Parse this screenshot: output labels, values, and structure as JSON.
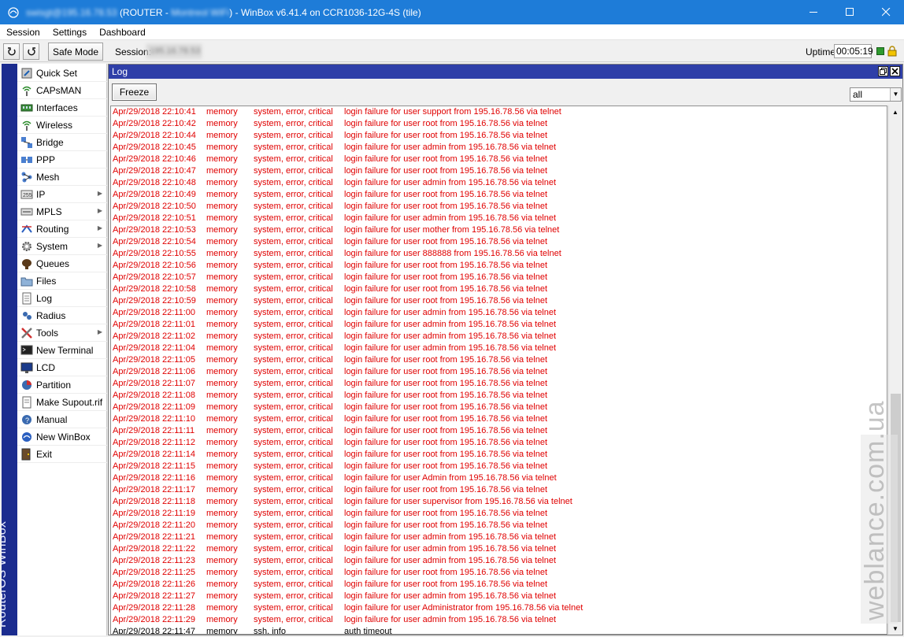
{
  "window": {
    "title_user_host": "swisgt@195.16.78.53",
    "title_router": "(ROUTER - ",
    "title_router_blurred": "Montreol WiFi",
    "title_suffix": ") - WinBox v6.41.4 on CCR1036-12G-4S (tile)",
    "controls": [
      "minimize",
      "maximize",
      "close"
    ]
  },
  "menubar": {
    "items": [
      "Session",
      "Settings",
      "Dashboard"
    ]
  },
  "toolbar": {
    "undo_icon": "undo-icon",
    "redo_icon": "redo-icon",
    "safe_mode_label": "Safe Mode",
    "session_label": "Session:",
    "session_value": "195.16.78.53",
    "uptime_label": "Uptime:",
    "uptime_value": "00:05:19",
    "status_color": "#2e9a2e"
  },
  "brand": {
    "text": "RouterOS WinBox"
  },
  "sidebar": {
    "items": [
      {
        "label": "Quick Set",
        "icon": "quickset-icon",
        "submenu": false
      },
      {
        "label": "CAPsMAN",
        "icon": "capsman-icon",
        "submenu": false
      },
      {
        "label": "Interfaces",
        "icon": "interfaces-icon",
        "submenu": false
      },
      {
        "label": "Wireless",
        "icon": "wireless-icon",
        "submenu": false
      },
      {
        "label": "Bridge",
        "icon": "bridge-icon",
        "submenu": false
      },
      {
        "label": "PPP",
        "icon": "ppp-icon",
        "submenu": false
      },
      {
        "label": "Mesh",
        "icon": "mesh-icon",
        "submenu": false
      },
      {
        "label": "IP",
        "icon": "ip-icon",
        "submenu": true
      },
      {
        "label": "MPLS",
        "icon": "mpls-icon",
        "submenu": true
      },
      {
        "label": "Routing",
        "icon": "routing-icon",
        "submenu": true
      },
      {
        "label": "System",
        "icon": "system-icon",
        "submenu": true
      },
      {
        "label": "Queues",
        "icon": "queues-icon",
        "submenu": false
      },
      {
        "label": "Files",
        "icon": "files-icon",
        "submenu": false
      },
      {
        "label": "Log",
        "icon": "log-icon",
        "submenu": false
      },
      {
        "label": "Radius",
        "icon": "radius-icon",
        "submenu": false
      },
      {
        "label": "Tools",
        "icon": "tools-icon",
        "submenu": true
      },
      {
        "label": "New Terminal",
        "icon": "terminal-icon",
        "submenu": false
      },
      {
        "label": "LCD",
        "icon": "lcd-icon",
        "submenu": false
      },
      {
        "label": "Partition",
        "icon": "partition-icon",
        "submenu": false
      },
      {
        "label": "Make Supout.rif",
        "icon": "supout-icon",
        "submenu": false
      },
      {
        "label": "Manual",
        "icon": "manual-icon",
        "submenu": false
      },
      {
        "label": "New WinBox",
        "icon": "winbox-icon",
        "submenu": false
      },
      {
        "label": "Exit",
        "icon": "exit-icon",
        "submenu": false
      }
    ]
  },
  "log_window": {
    "title": "Log",
    "freeze_label": "Freeze",
    "filter_value": "all",
    "error_color": "#e00000",
    "rows": [
      {
        "time": "Apr/29/2018 22:10:41",
        "buffer": "memory",
        "topics": "system, error, critical",
        "message": "login failure for user support from 195.16.78.56 via telnet",
        "level": "err"
      },
      {
        "time": "Apr/29/2018 22:10:42",
        "buffer": "memory",
        "topics": "system, error, critical",
        "message": "login failure for user root from 195.16.78.56 via telnet",
        "level": "err"
      },
      {
        "time": "Apr/29/2018 22:10:44",
        "buffer": "memory",
        "topics": "system, error, critical",
        "message": "login failure for user root from 195.16.78.56 via telnet",
        "level": "err"
      },
      {
        "time": "Apr/29/2018 22:10:45",
        "buffer": "memory",
        "topics": "system, error, critical",
        "message": "login failure for user admin from 195.16.78.56 via telnet",
        "level": "err"
      },
      {
        "time": "Apr/29/2018 22:10:46",
        "buffer": "memory",
        "topics": "system, error, critical",
        "message": "login failure for user root from 195.16.78.56 via telnet",
        "level": "err"
      },
      {
        "time": "Apr/29/2018 22:10:47",
        "buffer": "memory",
        "topics": "system, error, critical",
        "message": "login failure for user root from 195.16.78.56 via telnet",
        "level": "err"
      },
      {
        "time": "Apr/29/2018 22:10:48",
        "buffer": "memory",
        "topics": "system, error, critical",
        "message": "login failure for user admin from 195.16.78.56 via telnet",
        "level": "err"
      },
      {
        "time": "Apr/29/2018 22:10:49",
        "buffer": "memory",
        "topics": "system, error, critical",
        "message": "login failure for user root from 195.16.78.56 via telnet",
        "level": "err"
      },
      {
        "time": "Apr/29/2018 22:10:50",
        "buffer": "memory",
        "topics": "system, error, critical",
        "message": "login failure for user root from 195.16.78.56 via telnet",
        "level": "err"
      },
      {
        "time": "Apr/29/2018 22:10:51",
        "buffer": "memory",
        "topics": "system, error, critical",
        "message": "login failure for user admin from 195.16.78.56 via telnet",
        "level": "err"
      },
      {
        "time": "Apr/29/2018 22:10:53",
        "buffer": "memory",
        "topics": "system, error, critical",
        "message": "login failure for user mother from 195.16.78.56 via telnet",
        "level": "err"
      },
      {
        "time": "Apr/29/2018 22:10:54",
        "buffer": "memory",
        "topics": "system, error, critical",
        "message": "login failure for user root from 195.16.78.56 via telnet",
        "level": "err"
      },
      {
        "time": "Apr/29/2018 22:10:55",
        "buffer": "memory",
        "topics": "system, error, critical",
        "message": "login failure for user 888888 from 195.16.78.56 via telnet",
        "level": "err"
      },
      {
        "time": "Apr/29/2018 22:10:56",
        "buffer": "memory",
        "topics": "system, error, critical",
        "message": "login failure for user root from 195.16.78.56 via telnet",
        "level": "err"
      },
      {
        "time": "Apr/29/2018 22:10:57",
        "buffer": "memory",
        "topics": "system, error, critical",
        "message": "login failure for user root from 195.16.78.56 via telnet",
        "level": "err"
      },
      {
        "time": "Apr/29/2018 22:10:58",
        "buffer": "memory",
        "topics": "system, error, critical",
        "message": "login failure for user root from 195.16.78.56 via telnet",
        "level": "err"
      },
      {
        "time": "Apr/29/2018 22:10:59",
        "buffer": "memory",
        "topics": "system, error, critical",
        "message": "login failure for user root from 195.16.78.56 via telnet",
        "level": "err"
      },
      {
        "time": "Apr/29/2018 22:11:00",
        "buffer": "memory",
        "topics": "system, error, critical",
        "message": "login failure for user admin from 195.16.78.56 via telnet",
        "level": "err"
      },
      {
        "time": "Apr/29/2018 22:11:01",
        "buffer": "memory",
        "topics": "system, error, critical",
        "message": "login failure for user admin from 195.16.78.56 via telnet",
        "level": "err"
      },
      {
        "time": "Apr/29/2018 22:11:02",
        "buffer": "memory",
        "topics": "system, error, critical",
        "message": "login failure for user admin from 195.16.78.56 via telnet",
        "level": "err"
      },
      {
        "time": "Apr/29/2018 22:11:04",
        "buffer": "memory",
        "topics": "system, error, critical",
        "message": "login failure for user admin from 195.16.78.56 via telnet",
        "level": "err"
      },
      {
        "time": "Apr/29/2018 22:11:05",
        "buffer": "memory",
        "topics": "system, error, critical",
        "message": "login failure for user root from 195.16.78.56 via telnet",
        "level": "err"
      },
      {
        "time": "Apr/29/2018 22:11:06",
        "buffer": "memory",
        "topics": "system, error, critical",
        "message": "login failure for user root from 195.16.78.56 via telnet",
        "level": "err"
      },
      {
        "time": "Apr/29/2018 22:11:07",
        "buffer": "memory",
        "topics": "system, error, critical",
        "message": "login failure for user root from 195.16.78.56 via telnet",
        "level": "err"
      },
      {
        "time": "Apr/29/2018 22:11:08",
        "buffer": "memory",
        "topics": "system, error, critical",
        "message": "login failure for user root from 195.16.78.56 via telnet",
        "level": "err"
      },
      {
        "time": "Apr/29/2018 22:11:09",
        "buffer": "memory",
        "topics": "system, error, critical",
        "message": "login failure for user root from 195.16.78.56 via telnet",
        "level": "err"
      },
      {
        "time": "Apr/29/2018 22:11:10",
        "buffer": "memory",
        "topics": "system, error, critical",
        "message": "login failure for user root from 195.16.78.56 via telnet",
        "level": "err"
      },
      {
        "time": "Apr/29/2018 22:11:11",
        "buffer": "memory",
        "topics": "system, error, critical",
        "message": "login failure for user root from 195.16.78.56 via telnet",
        "level": "err"
      },
      {
        "time": "Apr/29/2018 22:11:12",
        "buffer": "memory",
        "topics": "system, error, critical",
        "message": "login failure for user root from 195.16.78.56 via telnet",
        "level": "err"
      },
      {
        "time": "Apr/29/2018 22:11:14",
        "buffer": "memory",
        "topics": "system, error, critical",
        "message": "login failure for user root from 195.16.78.56 via telnet",
        "level": "err"
      },
      {
        "time": "Apr/29/2018 22:11:15",
        "buffer": "memory",
        "topics": "system, error, critical",
        "message": "login failure for user root from 195.16.78.56 via telnet",
        "level": "err"
      },
      {
        "time": "Apr/29/2018 22:11:16",
        "buffer": "memory",
        "topics": "system, error, critical",
        "message": "login failure for user Admin from 195.16.78.56 via telnet",
        "level": "err"
      },
      {
        "time": "Apr/29/2018 22:11:17",
        "buffer": "memory",
        "topics": "system, error, critical",
        "message": "login failure for user root from 195.16.78.56 via telnet",
        "level": "err"
      },
      {
        "time": "Apr/29/2018 22:11:18",
        "buffer": "memory",
        "topics": "system, error, critical",
        "message": "login failure for user supervisor from 195.16.78.56 via telnet",
        "level": "err"
      },
      {
        "time": "Apr/29/2018 22:11:19",
        "buffer": "memory",
        "topics": "system, error, critical",
        "message": "login failure for user root from 195.16.78.56 via telnet",
        "level": "err"
      },
      {
        "time": "Apr/29/2018 22:11:20",
        "buffer": "memory",
        "topics": "system, error, critical",
        "message": "login failure for user root from 195.16.78.56 via telnet",
        "level": "err"
      },
      {
        "time": "Apr/29/2018 22:11:21",
        "buffer": "memory",
        "topics": "system, error, critical",
        "message": "login failure for user admin from 195.16.78.56 via telnet",
        "level": "err"
      },
      {
        "time": "Apr/29/2018 22:11:22",
        "buffer": "memory",
        "topics": "system, error, critical",
        "message": "login failure for user admin from 195.16.78.56 via telnet",
        "level": "err"
      },
      {
        "time": "Apr/29/2018 22:11:23",
        "buffer": "memory",
        "topics": "system, error, critical",
        "message": "login failure for user admin from 195.16.78.56 via telnet",
        "level": "err"
      },
      {
        "time": "Apr/29/2018 22:11:25",
        "buffer": "memory",
        "topics": "system, error, critical",
        "message": "login failure for user root from 195.16.78.56 via telnet",
        "level": "err"
      },
      {
        "time": "Apr/29/2018 22:11:26",
        "buffer": "memory",
        "topics": "system, error, critical",
        "message": "login failure for user root from 195.16.78.56 via telnet",
        "level": "err"
      },
      {
        "time": "Apr/29/2018 22:11:27",
        "buffer": "memory",
        "topics": "system, error, critical",
        "message": "login failure for user admin from 195.16.78.56 via telnet",
        "level": "err"
      },
      {
        "time": "Apr/29/2018 22:11:28",
        "buffer": "memory",
        "topics": "system, error, critical",
        "message": "login failure for user Administrator from 195.16.78.56 via telnet",
        "level": "err"
      },
      {
        "time": "Apr/29/2018 22:11:29",
        "buffer": "memory",
        "topics": "system, error, critical",
        "message": "login failure for user admin from 195.16.78.56 via telnet",
        "level": "err"
      },
      {
        "time": "Apr/29/2018 22:11:47",
        "buffer": "memory",
        "topics": "ssh, info",
        "message": "auth timeout",
        "level": "info"
      }
    ]
  },
  "watermark": {
    "text": "weblance.com.ua"
  }
}
